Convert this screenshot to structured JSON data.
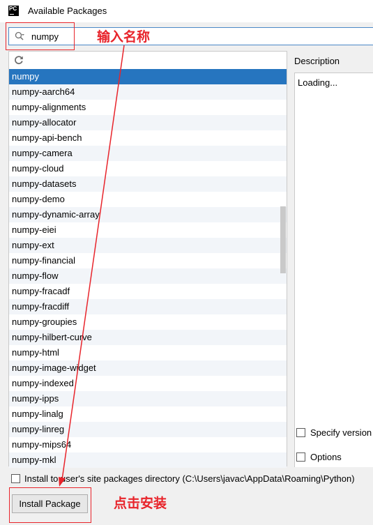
{
  "window": {
    "app_icon_text": "PC",
    "title": "Available Packages"
  },
  "search": {
    "value": "numpy"
  },
  "packages": [
    "numpy",
    "numpy-aarch64",
    "numpy-alignments",
    "numpy-allocator",
    "numpy-api-bench",
    "numpy-camera",
    "numpy-cloud",
    "numpy-datasets",
    "numpy-demo",
    "numpy-dynamic-array",
    "numpy-eiei",
    "numpy-ext",
    "numpy-financial",
    "numpy-flow",
    "numpy-fracadf",
    "numpy-fracdiff",
    "numpy-groupies",
    "numpy-hilbert-curve",
    "numpy-html",
    "numpy-image-widget",
    "numpy-indexed",
    "numpy-ipps",
    "numpy-linalg",
    "numpy-linreg",
    "numpy-mips64",
    "numpy-mkl"
  ],
  "selected_index": 0,
  "description": {
    "label": "Description",
    "status": "Loading..."
  },
  "options": {
    "specify_version": "Specify version",
    "options": "Options"
  },
  "install_to_user": {
    "label": "Install to user's site packages directory (C:\\Users\\javac\\AppData\\Roaming\\Python)"
  },
  "install_button": "Install Package",
  "annotations": {
    "enter_name": "输入名称",
    "click_install": "点击安装",
    "color": "#e8242b"
  },
  "colors": {
    "selection": "#2675bf",
    "focus_border": "#4a88c7"
  }
}
